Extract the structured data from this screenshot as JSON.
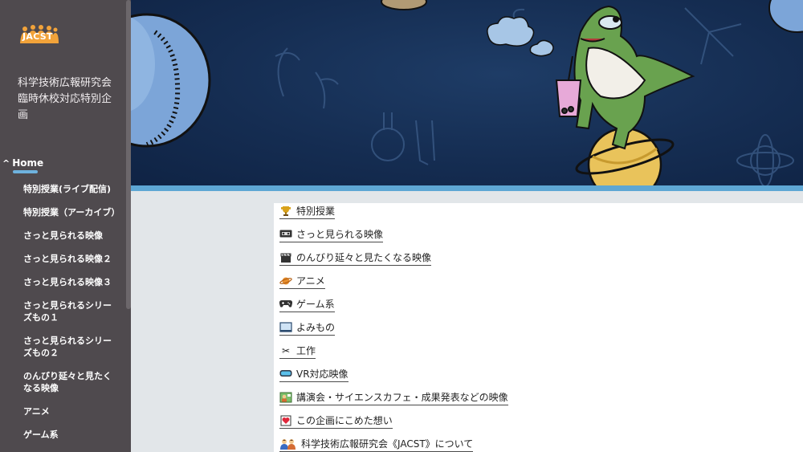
{
  "sidebar": {
    "logo_text": "JACST",
    "site_title": "科学技術広報研究会 臨時休校対応特別企画",
    "home_label": "Home",
    "items": [
      {
        "label": "特別授業(ライブ配信)"
      },
      {
        "label": "特別授業（アーカイブ）"
      },
      {
        "label": "さっと見られる映像"
      },
      {
        "label": "さっと見られる映像２"
      },
      {
        "label": "さっと見られる映像３"
      },
      {
        "label": "さっと見られるシリーズもの１"
      },
      {
        "label": "さっと見られるシリーズもの２"
      },
      {
        "label": "のんびり延々と見たくなる映像"
      },
      {
        "label": "アニメ"
      },
      {
        "label": "ゲーム系"
      }
    ]
  },
  "main": {
    "links": [
      {
        "icon": "trophy-icon",
        "label": "特別授業"
      },
      {
        "icon": "videotape-icon",
        "label": "さっと見られる映像"
      },
      {
        "icon": "clapperboard-icon",
        "label": "のんびり延々と見たくなる映像"
      },
      {
        "icon": "planet-icon",
        "label": "アニメ"
      },
      {
        "icon": "gamepad-icon",
        "label": "ゲーム系"
      },
      {
        "icon": "book-icon",
        "label": "よみもの"
      },
      {
        "icon": "scissors-icon",
        "label": "工作"
      },
      {
        "icon": "vr-goggles-icon",
        "label": "VR対応映像"
      },
      {
        "icon": "lecture-icon",
        "label": "講演会・サイエンスカフェ・成果発表などの映像"
      },
      {
        "icon": "heart-letter-icon",
        "label": "この企画にこめた想い"
      },
      {
        "icon": "people-icon",
        "label": "科学技術広報研究会《JACST》について"
      }
    ]
  },
  "colors": {
    "sidebar_bg": "#4f4a4e",
    "accent": "#5ea7d4",
    "banner_bg": "#152d52"
  }
}
